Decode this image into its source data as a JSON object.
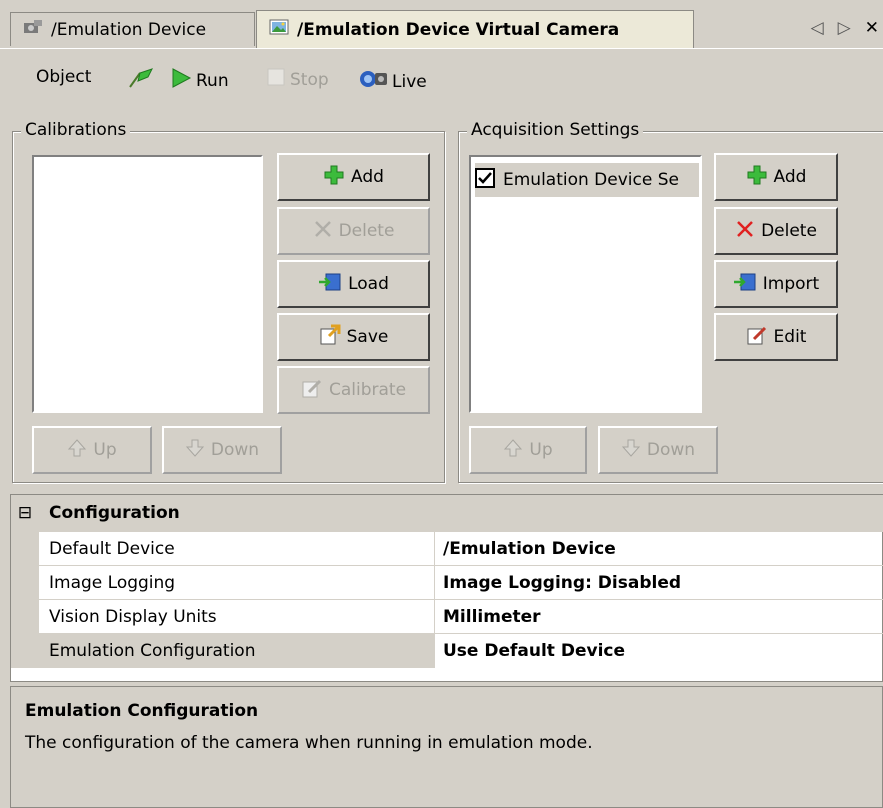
{
  "tabs": [
    {
      "label": "/Emulation Device",
      "icon": "device-icon"
    },
    {
      "label": "/Emulation Device Virtual Camera",
      "icon": "camera-image-icon"
    }
  ],
  "toolbar": {
    "object_label": "Object",
    "run_label": "Run",
    "stop_label": "Stop",
    "live_label": "Live"
  },
  "calibrations": {
    "title": "Calibrations",
    "buttons": {
      "add": "Add",
      "delete": "Delete",
      "load": "Load",
      "save": "Save",
      "calibrate": "Calibrate",
      "up": "Up",
      "down": "Down"
    }
  },
  "acquisition": {
    "title": "Acquisition Settings",
    "items": [
      {
        "label": "Emulation Device Se",
        "checked": true
      }
    ],
    "buttons": {
      "add": "Add",
      "delete": "Delete",
      "import": "Import",
      "edit": "Edit",
      "up": "Up",
      "down": "Down"
    }
  },
  "config": {
    "header": "Configuration",
    "collapse_symbol": "⊟",
    "rows": [
      {
        "name": "Default Device",
        "value": "/Emulation Device"
      },
      {
        "name": "Image Logging",
        "value": "Image Logging: Disabled"
      },
      {
        "name": "Vision Display Units",
        "value": "Millimeter"
      },
      {
        "name": "Emulation Configuration",
        "value": "Use Default Device"
      }
    ]
  },
  "description": {
    "title": "Emulation Configuration",
    "text": "The configuration of the camera when running in emulation mode."
  },
  "colors": {
    "accent_green": "#2fa82f",
    "delete_red": "#e02020",
    "selected_bg": "#d4d0c8"
  }
}
